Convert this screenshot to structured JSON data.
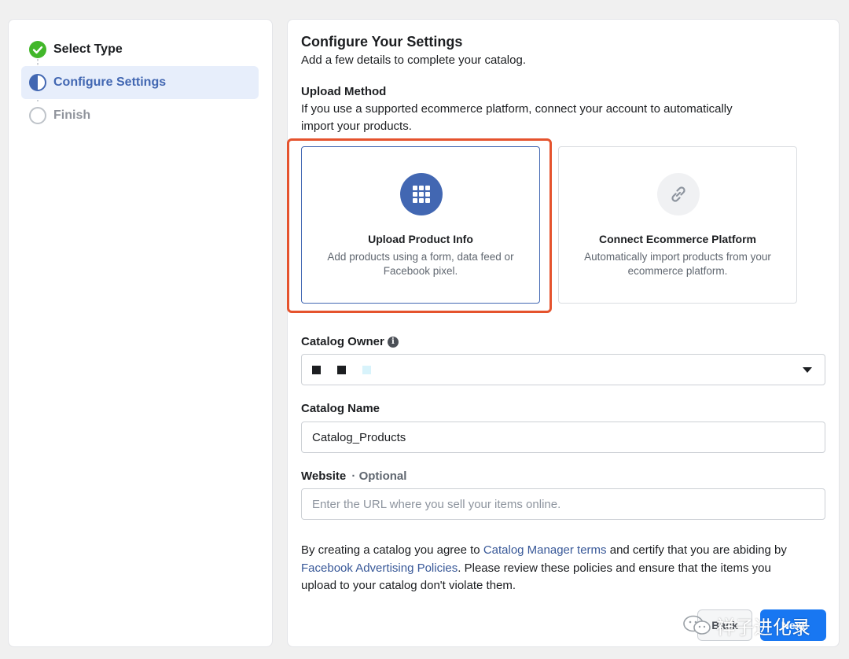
{
  "steps": [
    {
      "label": "Select Type",
      "state": "done"
    },
    {
      "label": "Configure Settings",
      "state": "active"
    },
    {
      "label": "Finish",
      "state": "todo"
    }
  ],
  "header": {
    "title": "Configure Your Settings",
    "subtitle": "Add a few details to complete your catalog."
  },
  "upload_method": {
    "label": "Upload Method",
    "description_line1": "If you use a supported ecommerce platform, connect your account to automatically",
    "description_line2": "import your products.",
    "options": [
      {
        "title": "Upload Product Info",
        "desc_line1": "Add products using a form, data feed or",
        "desc_line2": "Facebook pixel.",
        "icon": "grid-icon",
        "selected": true
      },
      {
        "title": "Connect Ecommerce Platform",
        "desc_line1": "Automatically import products from your",
        "desc_line2": "ecommerce platform.",
        "icon": "link-icon",
        "selected": false
      }
    ]
  },
  "catalog_owner": {
    "label": "Catalog Owner",
    "info_icon": "info-icon"
  },
  "catalog_name": {
    "label": "Catalog Name",
    "value": "Catalog_Products"
  },
  "website": {
    "label": "Website",
    "optional": "· Optional",
    "placeholder": "Enter the URL where you sell your items online."
  },
  "terms": {
    "t1": "By creating a catalog you agree to ",
    "link1": "Catalog Manager terms",
    "t2": " and certify that you are abiding by",
    "link2": "Facebook Advertising Policies",
    "t3": ". Please review these policies and ensure that the items you",
    "t4": "upload to your catalog don't violate them."
  },
  "buttons": {
    "back": "Back",
    "next": "Next"
  },
  "watermark": "祥子进化录",
  "colors": {
    "accent": "#4267b2",
    "done": "#42b72a",
    "highlight": "#e5532d",
    "link": "#385898"
  }
}
